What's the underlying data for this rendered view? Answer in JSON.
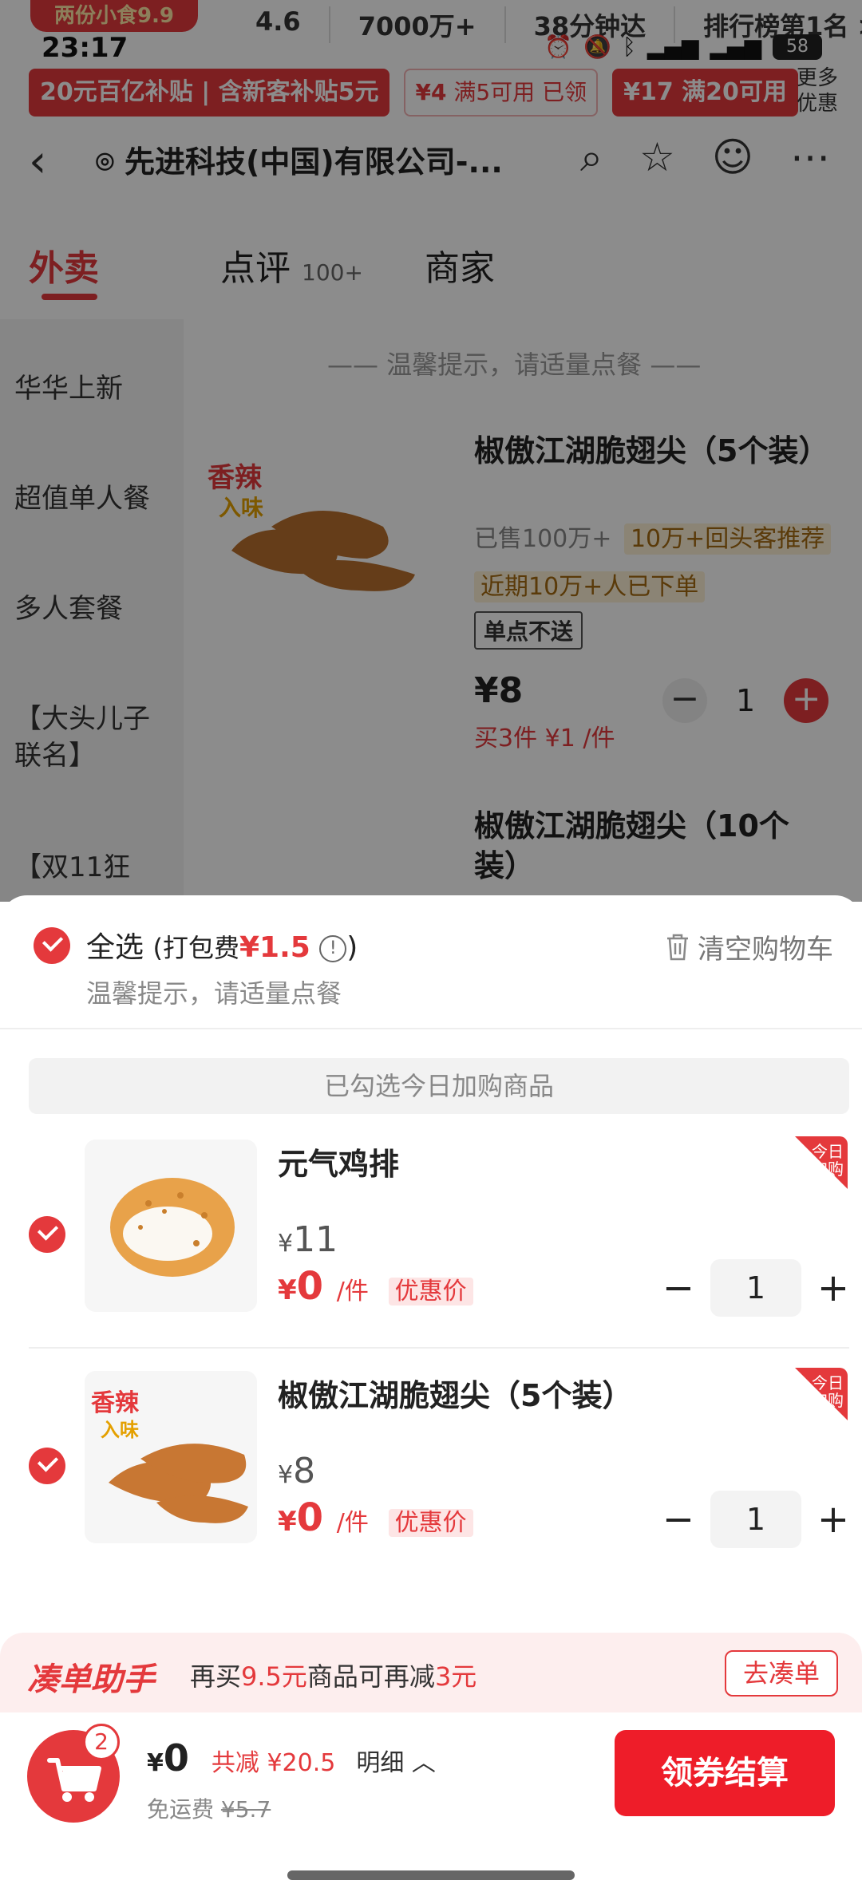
{
  "banner": {
    "logo": "两份小食9.9",
    "stats": [
      "4.6",
      "7000万+",
      "38分钟达",
      "排行榜第1名 >"
    ]
  },
  "status": {
    "time": "23:17",
    "battery": "58"
  },
  "coupons": {
    "subsidy": "20元百亿补贴 | 含新客补贴5元",
    "c1_amount": "¥4",
    "c1_cond": "满5可用",
    "c1_state": "已领",
    "c2_amount": "¥17",
    "c2_cond": "满20可用",
    "more": "更多优惠"
  },
  "nav": {
    "address": "先进科技(中国)有限公司-..."
  },
  "tabs": {
    "delivery": "外卖",
    "reviews": "点评",
    "reviews_count": "100+",
    "merchant": "商家"
  },
  "categories": [
    "华华上新",
    "超值单人餐",
    "多人套餐",
    "【大头儿子联名】",
    "【双11狂"
  ],
  "menu": {
    "tip": "—— 温馨提示，请适量点餐 ——",
    "product1": {
      "name": "椒傲江湖脆翅尖（5个装）",
      "sold": "已售100万+",
      "tag1": "10万+回头客推荐",
      "tag2": "近期10万+人已下单",
      "tag3": "单点不送",
      "price": "¥8",
      "promo": "买3件 ¥1 /件",
      "qty": "1"
    },
    "product2": {
      "name": "椒傲江湖脆翅尖（10个装）"
    }
  },
  "cart": {
    "select_all": "全选",
    "pack_fee_label": "(打包费",
    "pack_fee": "¥1.5",
    "pack_fee_close": ")",
    "tip": "温馨提示，请适量点餐",
    "clear": "清空购物车",
    "section": "已勾选今日加购商品",
    "items": [
      {
        "name": "元气鸡排",
        "orig_price": "11",
        "price": "0",
        "unit": "/件",
        "deal": "优惠价",
        "qty": "1",
        "badge1": "今日",
        "badge2": "加购"
      },
      {
        "name": "椒傲江湖脆翅尖（5个装）",
        "orig_price": "8",
        "price": "0",
        "unit": "/件",
        "deal": "优惠价",
        "qty": "1",
        "badge1": "今日",
        "badge2": "加购"
      }
    ]
  },
  "helper": {
    "logo": "凑单助手",
    "text_a": "再买",
    "amount": "9.5元",
    "text_b": "商品可再减",
    "discount": "3元",
    "button": "去凑单"
  },
  "checkout": {
    "badge": "2",
    "yen": "¥",
    "total": "0",
    "saved": "共减 ¥20.5",
    "detail": "明细 ︿",
    "shipping_label": "免运费",
    "shipping_orig": "¥5.7",
    "button": "领券结算"
  },
  "colors": {
    "accent": "#e4393c",
    "checkout": "#ee1d29"
  }
}
